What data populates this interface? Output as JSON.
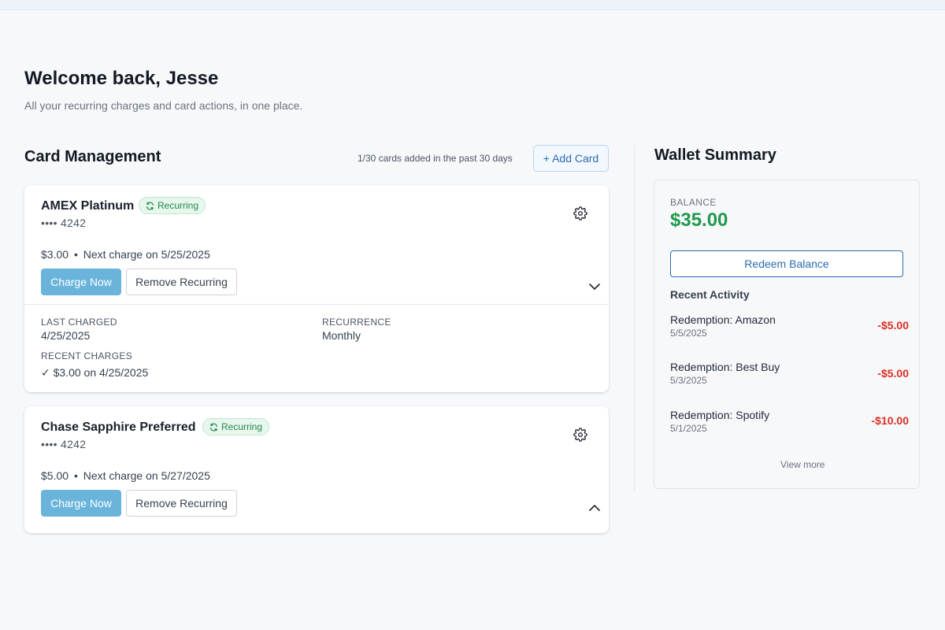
{
  "header": {
    "welcome": "Welcome back, Jesse",
    "subtitle": "All your recurring charges and card actions, in one place."
  },
  "card_management": {
    "title": "Card Management",
    "count_text": "1/30 cards added in the past 30 days",
    "add_card_label": "+ Add Card",
    "cards": [
      {
        "name": "AMEX Platinum",
        "badge": "Recurring",
        "number": "•••• 4242",
        "charge_amount": "$3.00",
        "separator": "•",
        "next_charge": "Next charge on 5/25/2025",
        "charge_now_label": "Charge Now",
        "remove_label": "Remove Recurring",
        "expanded": true,
        "details": {
          "last_charged_label": "LAST CHARGED",
          "last_charged_value": "4/25/2025",
          "recurrence_label": "RECURRENCE",
          "recurrence_value": "Monthly",
          "recent_charges_label": "RECENT CHARGES",
          "recent_charges": [
            "✓ $3.00 on 4/25/2025"
          ]
        }
      },
      {
        "name": "Chase Sapphire Preferred",
        "badge": "Recurring",
        "number": "•••• 4242",
        "charge_amount": "$5.00",
        "separator": "•",
        "next_charge": "Next charge on 5/27/2025",
        "charge_now_label": "Charge Now",
        "remove_label": "Remove Recurring",
        "expanded": false
      }
    ]
  },
  "wallet_summary": {
    "title": "Wallet Summary",
    "balance_label": "BALANCE",
    "balance_value": "$35.00",
    "redeem_label": "Redeem Balance",
    "recent_activity_title": "Recent Activity",
    "activities": [
      {
        "name": "Redemption: Amazon",
        "date": "5/5/2025",
        "amount": "-$5.00"
      },
      {
        "name": "Redemption: Best Buy",
        "date": "5/3/2025",
        "amount": "-$5.00"
      },
      {
        "name": "Redemption: Spotify",
        "date": "5/1/2025",
        "amount": "-$10.00"
      }
    ],
    "view_more_label": "View more"
  },
  "colors": {
    "accent_blue": "#2b6cb0",
    "charge_button": "#6ab4dc",
    "balance_green": "#1f9a4e",
    "negative_red": "#d93025",
    "badge_green": "#23874d"
  },
  "icons": [
    "refresh-icon",
    "gear-icon",
    "chevron-down-icon",
    "chevron-up-icon",
    "checkmark-icon"
  ]
}
